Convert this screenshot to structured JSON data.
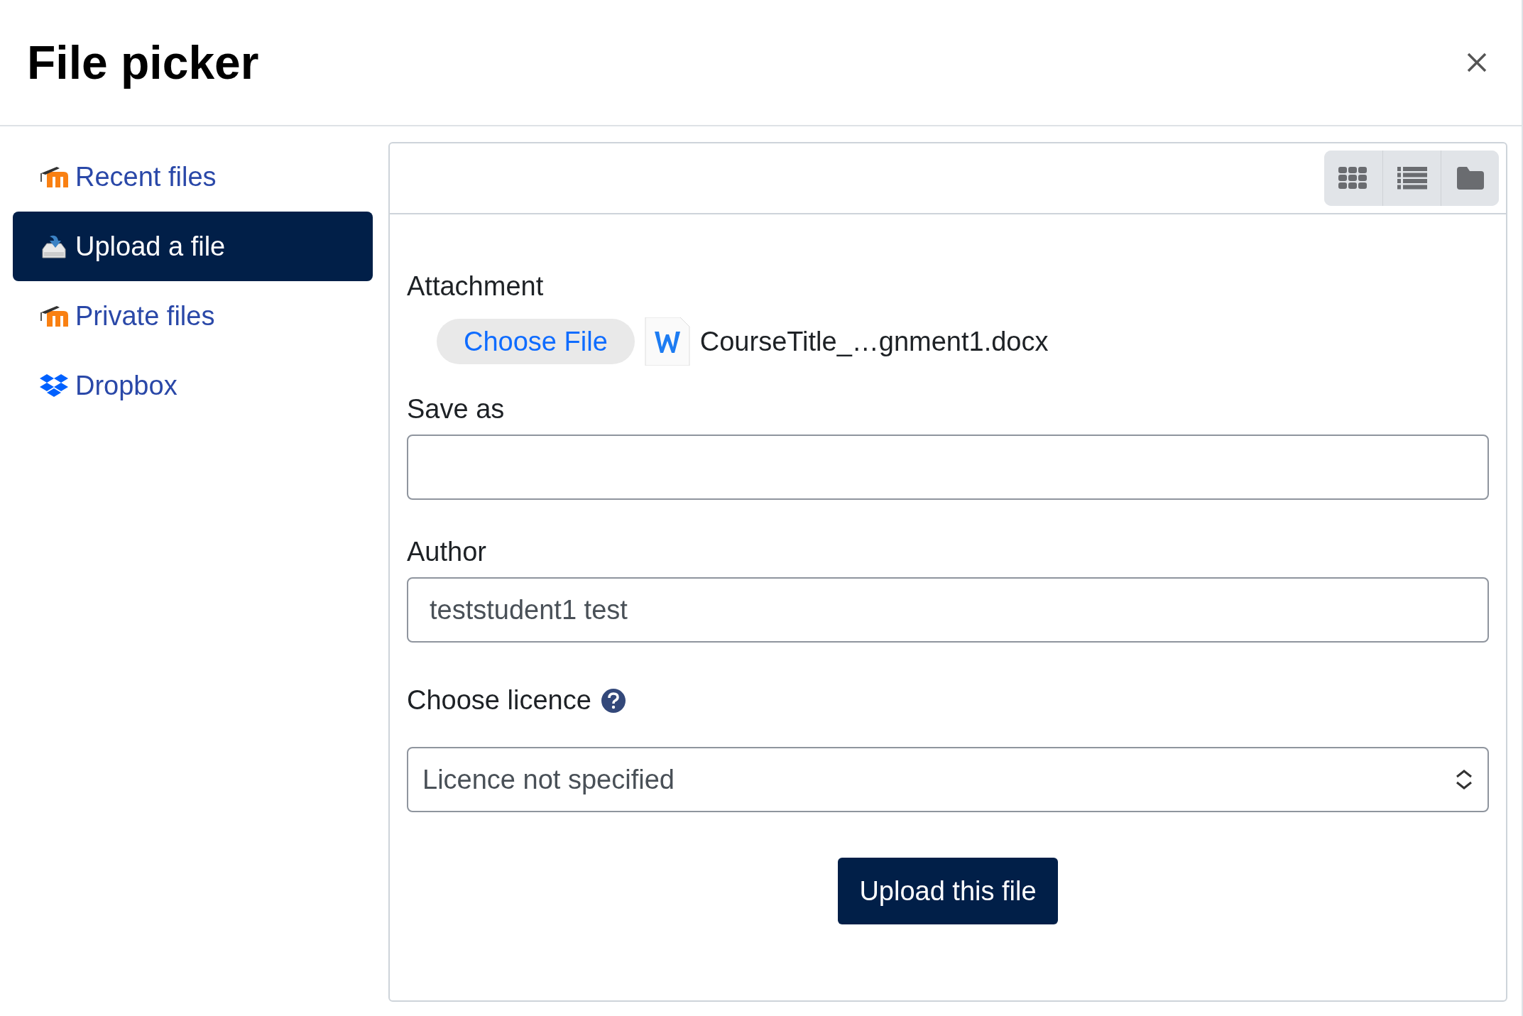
{
  "dialog": {
    "title": "File picker"
  },
  "sidebar": {
    "items": [
      {
        "label": "Recent files",
        "kind": "moodle",
        "selected": false
      },
      {
        "label": "Upload a file",
        "kind": "upload",
        "selected": true
      },
      {
        "label": "Private files",
        "kind": "moodle",
        "selected": false
      },
      {
        "label": "Dropbox",
        "kind": "dropbox",
        "selected": false
      }
    ]
  },
  "form": {
    "attachment": {
      "label": "Attachment",
      "button": "Choose File",
      "file_name": "CourseTitle_…gnment1.docx"
    },
    "save_as": {
      "label": "Save as"
    },
    "author": {
      "label": "Author",
      "value": "teststudent1 test"
    },
    "licence": {
      "label": "Choose licence",
      "value": "Licence not specified"
    },
    "submit": "Upload this file"
  }
}
